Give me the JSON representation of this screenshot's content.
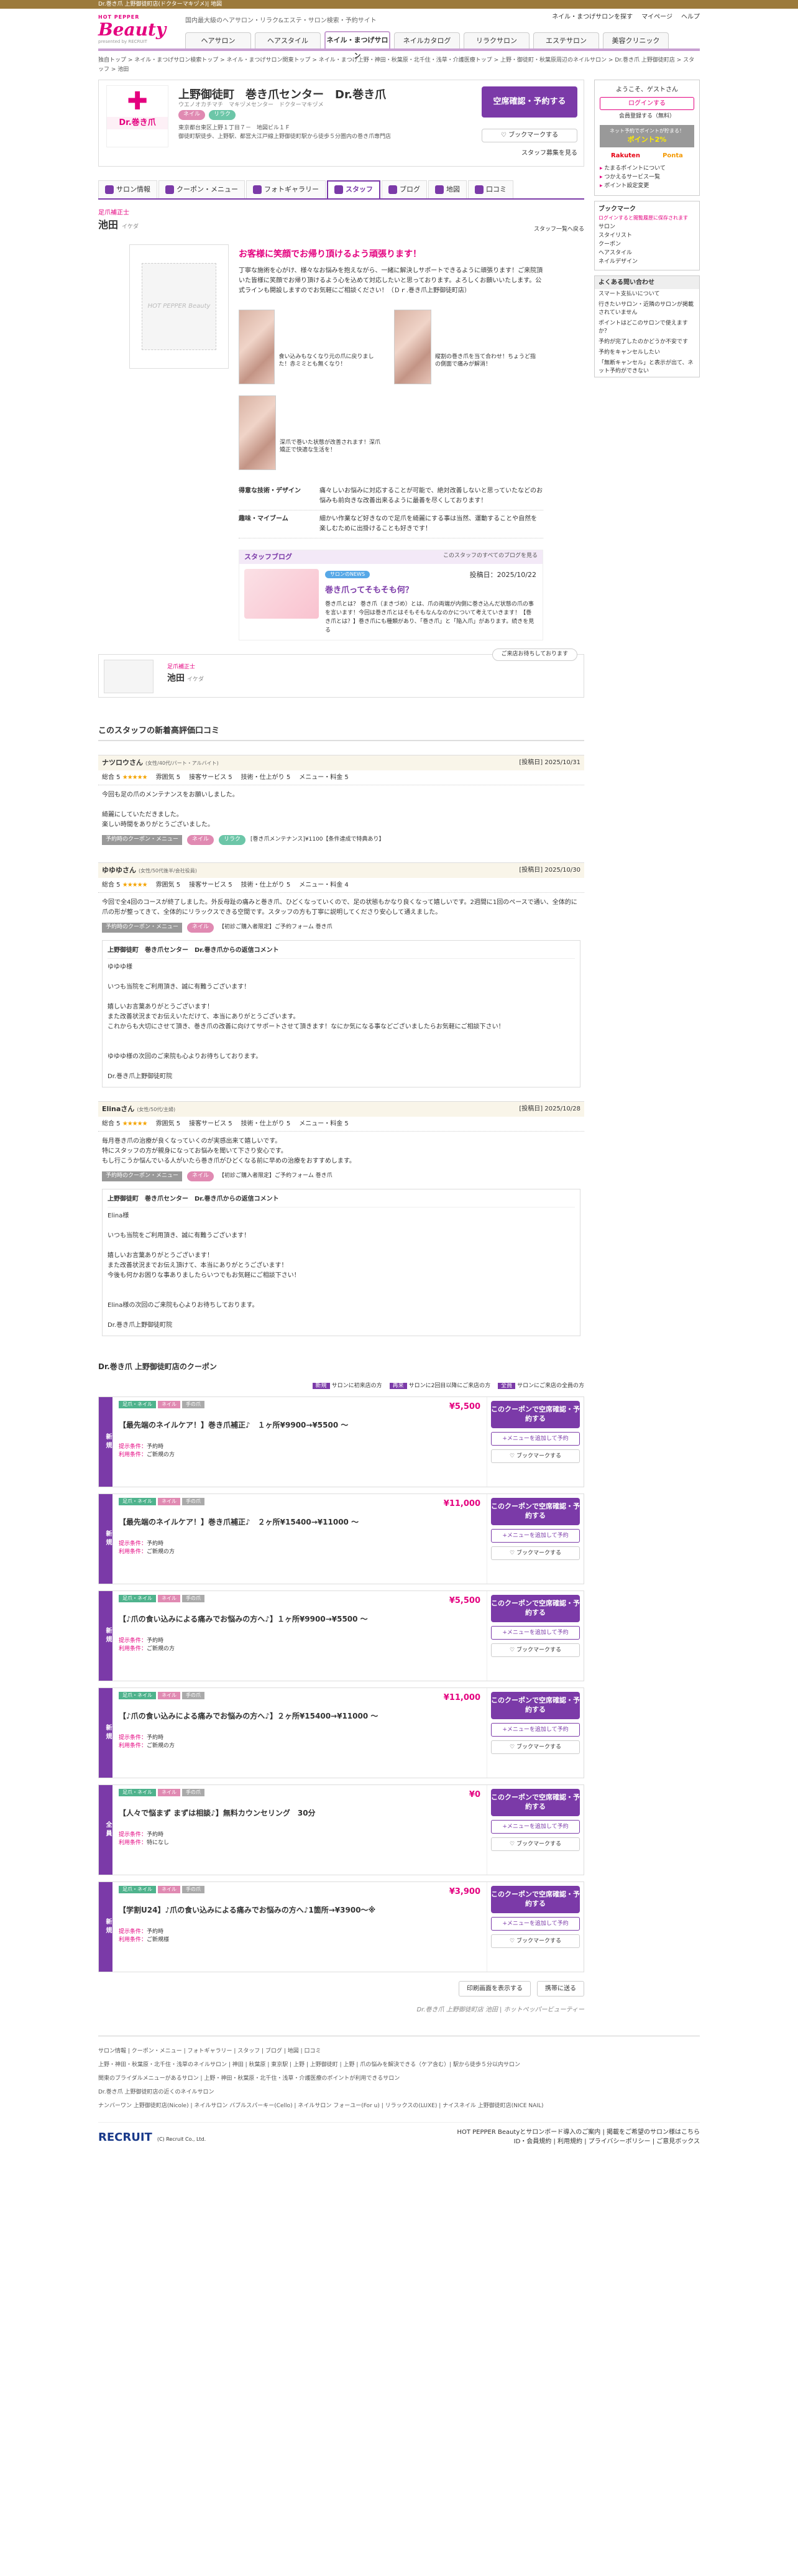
{
  "topbar": "Dr.巻き爪 上野御徒町店(ドクターマキヅメ)| 地図",
  "logo": {
    "top": "HOT PEPPER",
    "main": "Beauty",
    "sub": "presented by RECRUIT"
  },
  "tagline": "国内最大級のヘアサロン・リラク&エステ・サロン検索・予約サイト",
  "header_links": [
    "ネイル・まつげサロンを探す",
    "マイページ",
    "ヘルプ"
  ],
  "gnav": [
    "ヘアサロン",
    "ヘアスタイル",
    "ネイル・まつげサロン",
    "ネイルカタログ",
    "リラクサロン",
    "エステサロン",
    "美容クリニック"
  ],
  "breadcrumb": "独自トップ > ネイル・まつげサロン検索トップ > ネイル・まつげサロン関東トップ > ネイル・まつげ上野・神田・秋葉原・北千住・浅草・介護医療トップ > 上野・御徒町・秋葉原周辺のネイルサロン > Dr.巻き爪 上野御徒町店 > スタッフ > 池田",
  "salon": {
    "logo_label": "Dr.巻き爪",
    "name": "上野御徒町　巻き爪センター　Dr.巻き爪",
    "kana": "ウエノオカチマチ　マキヅメセンター　ドクターマキヅメ",
    "tags": [
      "ネイル",
      "リラク"
    ],
    "desc": "東京都台東区上野１丁目７－　地図ビル１Ｆ\n御徒町駅徒歩、上野駅、都営大江戸線上野御徒町駅から徒歩５分圏内の巻き爪専門店",
    "reserve": "空席確認・予約する",
    "bookmark": "ブックマークする",
    "staff_link": "スタッフ募集を見る"
  },
  "tabs": [
    "サロン情報",
    "クーポン・メニュー",
    "フォトギャラリー",
    "スタッフ",
    "ブログ",
    "地図",
    "口コミ"
  ],
  "staff": {
    "position": "足爪補正士",
    "name": "池田",
    "kana": "イケダ",
    "next": "スタッフ一覧へ戻る",
    "photo_alt": "HOT PEPPER Beauty",
    "catch": "お客様に笑顔でお帰り頂けるよう頑張ります！",
    "intro": "丁寧な施術を心がけ、様々なお悩みを抱えながら、一緒に解決しサポートできるように頑張ります！ご来院頂いた皆様に笑顔でお帰り頂けるよう心を込めて対応したいと思っております。よろしくお願いいたします。公式ラインも開設しますのでお気軽にご相談ください！（Ｄｒ.巻き爪上野御徒町店）",
    "gallery": [
      "食い込みもなくなり元の爪に戻りました！赤ミミとも無くなり！",
      "縦割の巻き爪を当て合わせ！ちょうど指の側面で痛みが解消！",
      "深爪で巻いた状態が改善されます！深爪矯正で快適な生活を！"
    ],
    "details": [
      {
        "k": "得意な技術・デザイン",
        "v": "痛々しいお悩みに対応することが可能で、絶対改善しないと思っていたなどのお悩みも前向きな改善出来るように最善を尽くしております！"
      },
      {
        "k": "趣味・マイブーム",
        "v": "細かい作業など好きなので足爪を綺麗にする事は当然、運動することや自然を楽しむために出掛けることも好きです！"
      }
    ]
  },
  "blog": {
    "head": "スタッフブログ",
    "more": "このスタッフのすべてのブログを見る",
    "category": "サロンのNEWS",
    "title": "巻き爪ってそもそも何？",
    "text": "巻き爪とは？ 巻き爪（まきづめ）とは、爪の両端が内側に巻き込んだ状態の爪の事を言います！今回は巻き爪とはそもそもなんなのかについて考えていきます！【巻き爪とは？】巻き爪にも種類があり、「巻き爪」と「陥入爪」があります。続きを見る",
    "date": "投稿日：2025/10/22"
  },
  "staff_mini": {
    "message": "ご来店お待ちしております",
    "position": "足爪補正士",
    "name": "池田",
    "kana": "イケダ"
  },
  "reviews_title": "このスタッフの新着高評価口コミ",
  "reviews": [
    {
      "name": "ナツロウさん",
      "attr": "(女性/40代/パート・アルバイト)",
      "date": "[投稿日] 2025/10/31",
      "total": "総合 5",
      "s1": "雰囲気 5",
      "s2": "接客サービス 5",
      "s3": "技術・仕上がり 5",
      "s4": "メニュー・料金 5",
      "text": "今回も足の爪のメンテナンスをお願いしました。\n\n綺麗にしていただきました。\n楽しい時間をありがとうございました。",
      "menu_label": "予約時のクーポン・メニュー",
      "menu": "[巻き爪メンテナンス]¥1100【条件達成で特典あり】"
    },
    {
      "name": "ゆゆゆさん",
      "attr": "(女性/50代後半/会社役員)",
      "date": "[投稿日] 2025/10/30",
      "total": "総合 5",
      "s1": "雰囲気 5",
      "s2": "接客サービス 5",
      "s3": "技術・仕上がり 5",
      "s4": "メニュー・料金 4",
      "text": "今回で全4回のコースが終了しました。外反母趾の痛みと巻き爪、ひどくなっていくので、足の状態もかなり良くなって嬉しいです。2週間に1回のペースで通い、全体的に爪の形が整ってきて、全体的にリラックスできる空間です。スタッフの方も丁寧に説明してくださり安心して通えました。",
      "menu_label": "予約時のクーポン・メニュー",
      "menu": "【初診ご購入者限定】ご予約フォーム 巻き爪",
      "reply_head": "上野御徒町　巻き爪センター　Dr.巻き爪からの返信コメント",
      "reply": "ゆゆゆ様\n\nいつも当院をご利用頂き、誠に有難うございます！\n\n嬉しいお言葉ありがとうございます！\nまた改善状況までお伝えいただけて、本当にありがとうございます。\nこれからも大切にさせて頂き、巻き爪の改善に向けてサポートさせて頂きます！なにか気になる事などございましたらお気軽にご相談下さい！\n\n\nゆゆゆ様の次回のご来院も心よりお待ちしております。\n\nDr.巻き爪上野御徒町院"
    },
    {
      "name": "Elinaさん",
      "attr": "(女性/50代/主婦)",
      "date": "[投稿日] 2025/10/28",
      "total": "総合 5",
      "s1": "雰囲気 5",
      "s2": "接客サービス 5",
      "s3": "技術・仕上がり 5",
      "s4": "メニュー・料金 5",
      "text": "毎月巻き爪の治療が良くなっていくのが実感出来て嬉しいです。\n特にスタッフの方が親身になってお悩みを聞いて下さり安心です。\nもし行こうか悩んでいる人がいたら巻き爪がひどくなる前に早めの治療をおすすめします。",
      "menu_label": "予約時のクーポン・メニュー",
      "menu": "【初診ご購入者限定】ご予約フォーム 巻き爪",
      "reply_head": "上野御徒町　巻き爪センター　Dr.巻き爪からの返信コメント",
      "reply": "Elina様\n\nいつも当院をご利用頂き、誠に有難うございます！\n\n嬉しいお言葉ありがとうございます！\nまた改善状況までお伝え頂けて、本当にありがとうございます！\n今後も何かお困りな事ありましたらいつでもお気軽にご相談下さい！\n\n\nElina様の次回のご来院も心よりお待ちしております。\n\nDr.巻き爪上野御徒町院"
    }
  ],
  "coupons_title": "Dr.巻き爪 上野御徒町店のクーポン",
  "legend": [
    {
      "b": "新規",
      "t": "サロンに初来店の方"
    },
    {
      "b": "再来",
      "t": "サロンに2回目以降にご来店の方"
    },
    {
      "b": "全員",
      "t": "サロンにご来店の全員の方"
    }
  ],
  "coupons": [
    {
      "side": "新規",
      "tags": [
        "足爪・ネイル",
        "ネイル",
        "手の爪"
      ],
      "price": "¥5,500",
      "name": "【最先端のネイルケア！】巻き爪補正♪　１ヶ所¥9900→¥5500 ～",
      "cond1": "予約時",
      "cond2": "ご新規の方"
    },
    {
      "side": "新規",
      "tags": [
        "足爪・ネイル",
        "ネイル",
        "手の爪"
      ],
      "price": "¥11,000",
      "name": "【最先端のネイルケア！】巻き爪補正♪　２ヶ所¥15400→¥11000 ～",
      "cond1": "予約時",
      "cond2": "ご新規の方"
    },
    {
      "side": "新規",
      "tags": [
        "足爪・ネイル",
        "ネイル",
        "手の爪"
      ],
      "price": "¥5,500",
      "name": "【♪爪の食い込みによる痛みでお悩みの方へ♪】１ヶ所¥9900→¥5500 ～",
      "cond1": "予約時",
      "cond2": "ご新規の方"
    },
    {
      "side": "新規",
      "tags": [
        "足爪・ネイル",
        "ネイル",
        "手の爪"
      ],
      "price": "¥11,000",
      "name": "【♪爪の食い込みによる痛みでお悩みの方へ♪】２ヶ所¥15400→¥11000 ～",
      "cond1": "予約時",
      "cond2": "ご新規の方"
    },
    {
      "side": "全員",
      "tags": [
        "足爪・ネイル",
        "ネイル",
        "手の爪"
      ],
      "price": "¥0",
      "name": "【人々で悩まず まずは相談♪】無料カウンセリング　30分",
      "cond1": "予約時",
      "cond2": "特になし"
    },
    {
      "side": "新規",
      "tags": [
        "足爪・ネイル",
        "ネイル",
        "手の爪"
      ],
      "price": "¥3,900",
      "name": "【学割U24】♪爪の食い込みによる痛みでお悩みの方へ♪1箇所→¥3900～※",
      "cond1": "予約時",
      "cond2": "ご新規様"
    }
  ],
  "coupon_btn": {
    "reserve": "このクーポンで空席確認・予約する",
    "add": "+メニューを追加して予約",
    "bm": "ブックマークする"
  },
  "coupon_cond_labels": {
    "c1": "提示条件：",
    "c2": "利用条件："
  },
  "bottom_btns": [
    "印刷画面を表示する",
    "携帯に送る"
  ],
  "salon_foot": "Dr.巻き爪 上野御徒町店 池田 | ホットペッパービューティー",
  "side": {
    "welcome": "ようこそ、ゲストさん",
    "login": "ログインする",
    "register": "会員登録する（無料）",
    "point": "ネット予約でポイントが貯まる！",
    "point_b": "ポイント2%",
    "pay1": "Rakuten",
    "pay2": "Ponta",
    "links": [
      "たまるポイントについて",
      "つかえるサービス一覧",
      "ポイント設定変更"
    ],
    "bm_head": "ブックマーク",
    "bm_note": "ログインすると閲覧履歴に保存されます",
    "bm_items": [
      "サロン",
      "スタイリスト",
      "クーポン",
      "ヘアスタイル",
      "ネイルデザイン"
    ],
    "faq_head": "よくある問い合わせ",
    "faq": [
      "スマート支払いについて",
      "行きたいサロン・近隣のサロンが掲載されていません",
      "ポイントはどこのサロンで使えますか？",
      "予約が完了したのかどうか不安です",
      "予約をキャンセルしたい",
      "「無断キャンセル」と表示が出て、ネット予約ができない"
    ]
  },
  "footer": {
    "row1": "サロン情報 | クーポン・メニュー | フォトギャラリー | スタッフ | ブログ | 地図 | 口コミ",
    "row2": "上野・神田・秋葉原・北千住・浅草のネイルサロン | 神田 | 秋葉原 | 東京駅 | 上野 | 上野御徒町 | 上野 | 爪の悩みを解決できる（ケア含む）| 駅から徒歩５分以内サロン",
    "row3": "関東のブライダルメニューがあるサロン | 上野・神田・秋葉原・北千住・浅草・介護医療のポイントが利用できるサロン",
    "row4": "Dr.巻き爪 上野御徒町店の近くのネイルサロン",
    "row5": "ナンバーワン 上野御徒町店(Nicole) | ネイルサロン バブルスパーキー(Cello) | ネイルサロン フォーユー(For u) | リラックスの(LUXE) | ナイスネイル 上野御徒町店(NICE NAIL)"
  },
  "foot_bottom": {
    "recruit": "RECRUIT",
    "copy": "(C) Recruit Co., Ltd.",
    "r1": "HOT PEPPER Beautyとサロンボード導入のご案内 | 掲載をご希望のサロン様はこちら",
    "r2": "ID・会員規約 | 利用規約 | プライバシーポリシー | ご意見ボックス"
  }
}
